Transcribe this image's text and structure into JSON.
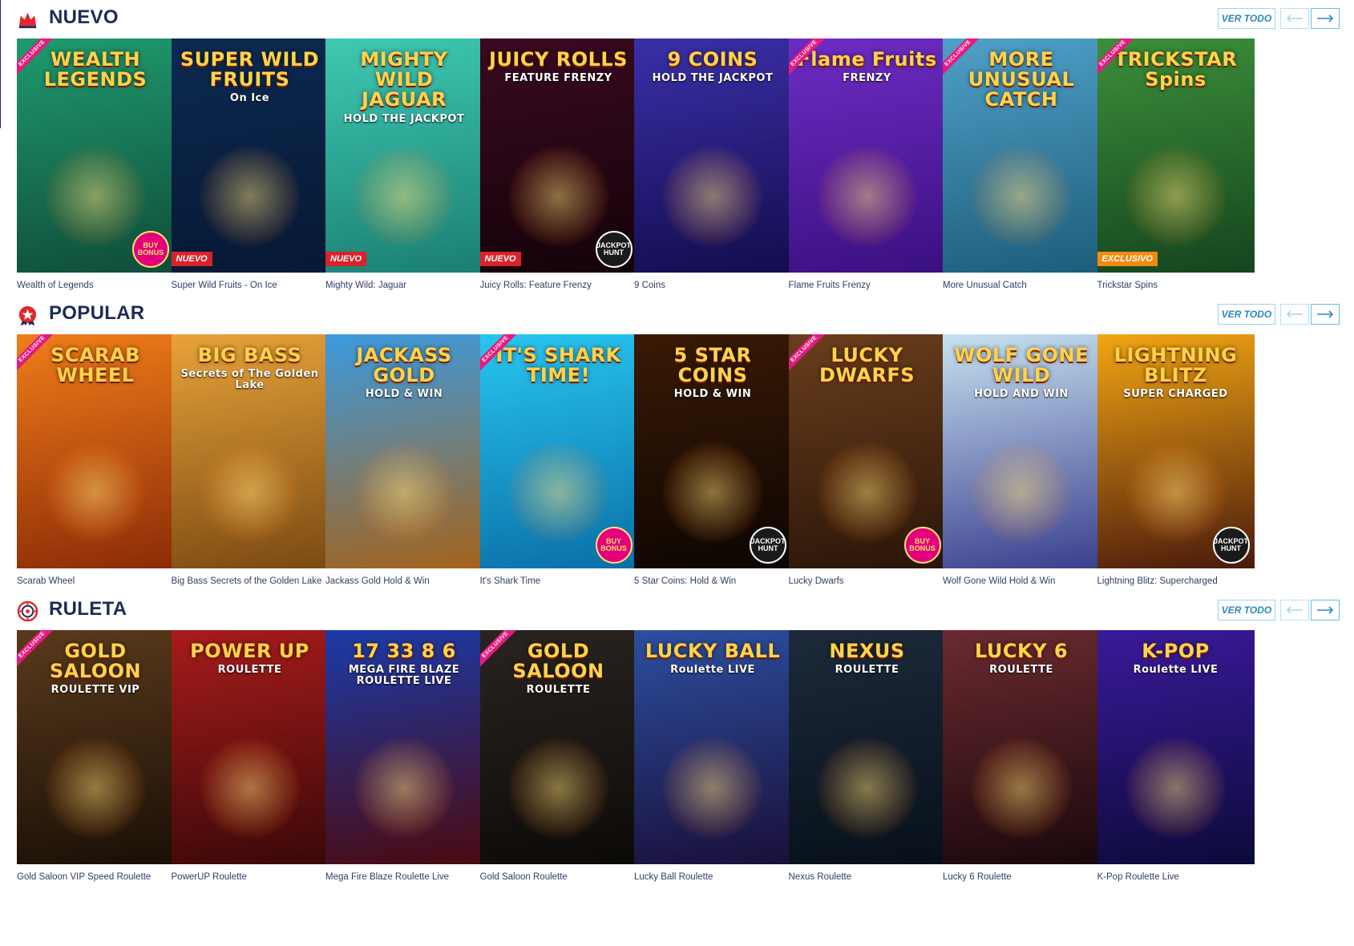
{
  "sections": [
    {
      "title": "NUEVO",
      "icon": "crown-icon",
      "view_all": "VER TODO",
      "prev_icon": "arrow-left-icon",
      "next_icon": "arrow-right-icon",
      "games": [
        {
          "name": "Wealth of Legends",
          "art": "WEALTH LEGENDS",
          "bg": [
            "#1f9a6d",
            "#0f4d3a"
          ],
          "ribbon": "EXCLUSIVE",
          "seal": "BUY BONUS"
        },
        {
          "name": "Super Wild Fruits - On Ice",
          "art": "SUPER WILD FRUITS",
          "art_sub": "On Ice",
          "bg": [
            "#0c2a52",
            "#061833"
          ],
          "badge": "NUEVO"
        },
        {
          "name": "Mighty Wild: Jaguar",
          "art": "MIGHTY WILD JAGUAR",
          "art_sub": "HOLD THE JACKPOT",
          "bg": [
            "#3ec9b3",
            "#1b7f73"
          ],
          "badge": "NUEVO"
        },
        {
          "name": "Juicy Rolls: Feature Frenzy",
          "art": "JUICY ROLLS",
          "art_sub": "FEATURE FRENZY",
          "bg": [
            "#3a0a20",
            "#140209"
          ],
          "badge": "NUEVO",
          "seal": "JACKPOT HUNT"
        },
        {
          "name": "9 Coins",
          "art": "9 COINS",
          "art_sub": "HOLD THE JACKPOT",
          "bg": [
            "#3b2fa8",
            "#120d4e"
          ]
        },
        {
          "name": "Flame Fruits Frenzy",
          "art": "Flame Fruits",
          "art_sub": "FRENZY",
          "bg": [
            "#6e2cc4",
            "#3a1080"
          ],
          "ribbon": "EXCLUSIVE"
        },
        {
          "name": "More Unusual Catch",
          "art": "MORE UNUSUAL CATCH",
          "bg": [
            "#4fa0c9",
            "#1d5d7a"
          ],
          "ribbon": "EXCLUSIVE"
        },
        {
          "name": "Trickstar Spins",
          "art": "TRICKSTAR Spins",
          "bg": [
            "#3c8f3a",
            "#15451e"
          ],
          "ribbon": "EXCLUSIVE",
          "badge": "EXCLUSIVO"
        }
      ]
    },
    {
      "title": "POPULAR",
      "icon": "star-badge-icon",
      "view_all": "VER TODO",
      "prev_icon": "arrow-left-icon",
      "next_icon": "arrow-right-icon",
      "games": [
        {
          "name": "Scarab Wheel",
          "art": "SCARAB WHEEL",
          "bg": [
            "#f07d1a",
            "#8c2b07"
          ],
          "ribbon": "EXCLUSIVE"
        },
        {
          "name": "Big Bass Secrets of the Golden Lake",
          "art": "BIG BASS",
          "art_sub": "Secrets of The Golden Lake",
          "bg": [
            "#e8a33a",
            "#7a4a12"
          ]
        },
        {
          "name": "Jackass Gold Hold & Win",
          "art": "JACKASS GOLD",
          "art_sub": "HOLD & WIN",
          "bg": [
            "#3c9be0",
            "#a4631c"
          ]
        },
        {
          "name": "It's Shark Time",
          "art": "IT'S SHARK TIME!",
          "bg": [
            "#28c6f0",
            "#0a6fa8"
          ],
          "ribbon": "EXCLUSIVE",
          "seal": "BUY BONUS"
        },
        {
          "name": "5 Star Coins: Hold & Win",
          "art": "5 STAR COINS",
          "art_sub": "HOLD & WIN",
          "bg": [
            "#3a1a05",
            "#0c0502"
          ],
          "seal": "JACKPOT HUNT"
        },
        {
          "name": "Lucky Dwarfs",
          "art": "LUCKY DWARFS",
          "bg": [
            "#6a3e1c",
            "#2a1508"
          ],
          "ribbon": "EXCLUSIVE",
          "seal": "BUY BONUS"
        },
        {
          "name": "Wolf Gone Wild Hold & Win",
          "art": "WOLF GONE WILD",
          "art_sub": "HOLD AND WIN",
          "bg": [
            "#c7e2f0",
            "#3a3f8f"
          ]
        },
        {
          "name": "Lightning Blitz: Supercharged",
          "art": "LIGHTNING BLITZ",
          "art_sub": "SUPER CHARGED",
          "bg": [
            "#f2a513",
            "#4a1a0c"
          ],
          "seal": "JACKPOT HUNT"
        }
      ]
    },
    {
      "title": "RULETA",
      "icon": "roulette-icon",
      "view_all": "VER TODO",
      "prev_icon": "arrow-left-icon",
      "next_icon": "arrow-right-icon",
      "games": [
        {
          "name": "Gold Saloon VIP Speed Roulette",
          "art": "GOLD SALOON",
          "art_sub": "ROULETTE VIP",
          "bg": [
            "#5a3a1c",
            "#1a0f06"
          ],
          "ribbon": "EXCLUSIVE"
        },
        {
          "name": "PowerUP Roulette",
          "art": "POWER UP",
          "art_sub": "ROULETTE",
          "bg": [
            "#a81c1c",
            "#3a0808"
          ]
        },
        {
          "name": "Mega Fire Blaze Roulette Live",
          "art": "17 33 8 6",
          "art_sub": "MEGA FIRE BLAZE ROULETTE LIVE",
          "bg": [
            "#1c3aa8",
            "#4a0a10"
          ]
        },
        {
          "name": "Gold Saloon Roulette",
          "art": "GOLD SALOON",
          "art_sub": "ROULETTE",
          "bg": [
            "#2a2420",
            "#0c0a08"
          ],
          "ribbon": "EXCLUSIVE"
        },
        {
          "name": "Lucky Ball Roulette",
          "art": "LUCKY BALL",
          "art_sub": "Roulette LIVE",
          "bg": [
            "#2c4fa0",
            "#1a0f3a"
          ]
        },
        {
          "name": "Nexus Roulette",
          "art": "NEXUS",
          "art_sub": "ROULETTE",
          "bg": [
            "#1c2a3a",
            "#07101a"
          ]
        },
        {
          "name": "Lucky 6 Roulette",
          "art": "LUCKY 6",
          "art_sub": "ROULETTE",
          "bg": [
            "#6a2a30",
            "#1a080c"
          ]
        },
        {
          "name": "K-Pop Roulette Live",
          "art": "K-POP",
          "art_sub": "Roulette LIVE",
          "bg": [
            "#3a1a9a",
            "#0c0a3a"
          ]
        }
      ]
    }
  ]
}
